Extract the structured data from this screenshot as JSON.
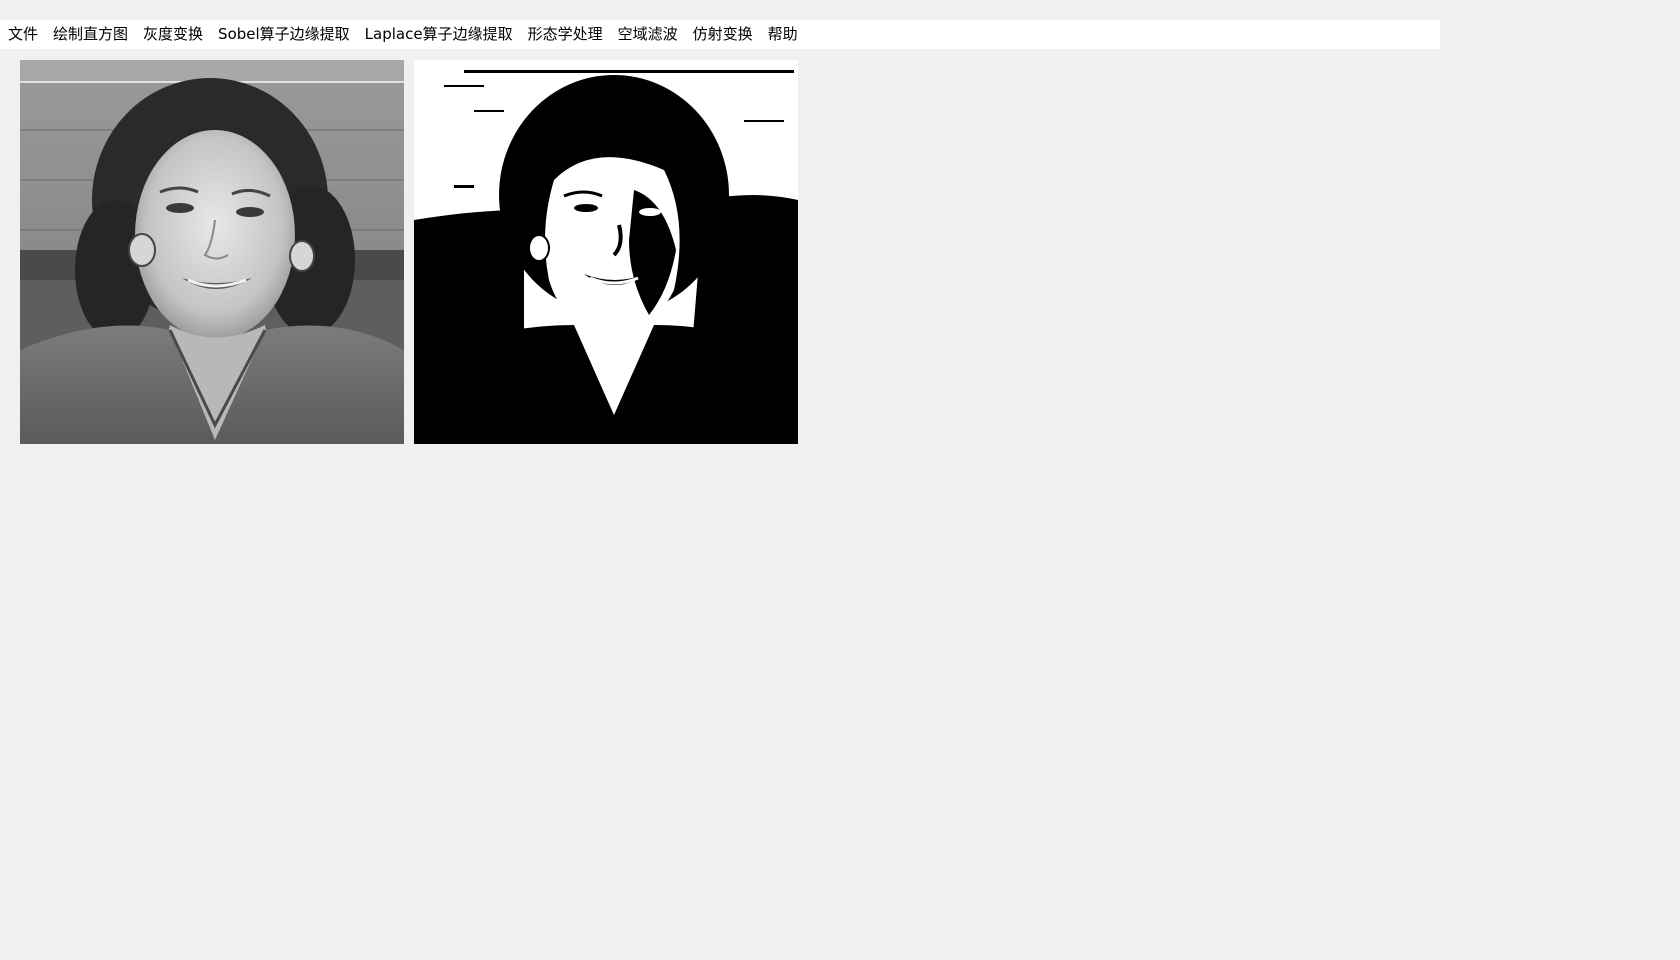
{
  "menubar": {
    "items": [
      {
        "label": "文件"
      },
      {
        "label": "绘制直方图"
      },
      {
        "label": "灰度变换"
      },
      {
        "label": "Sobel算子边缘提取"
      },
      {
        "label": "Laplace算子边缘提取"
      },
      {
        "label": "形态学处理"
      },
      {
        "label": "空域滤波"
      },
      {
        "label": "仿射变换"
      },
      {
        "label": "帮助"
      }
    ]
  },
  "images": {
    "original": {
      "description_icon": "grayscale-portrait-image"
    },
    "processed": {
      "description_icon": "binarized-portrait-image"
    }
  },
  "colors": {
    "background": "#f0f0f0",
    "menubar": "#ffffff",
    "text": "#000000"
  }
}
